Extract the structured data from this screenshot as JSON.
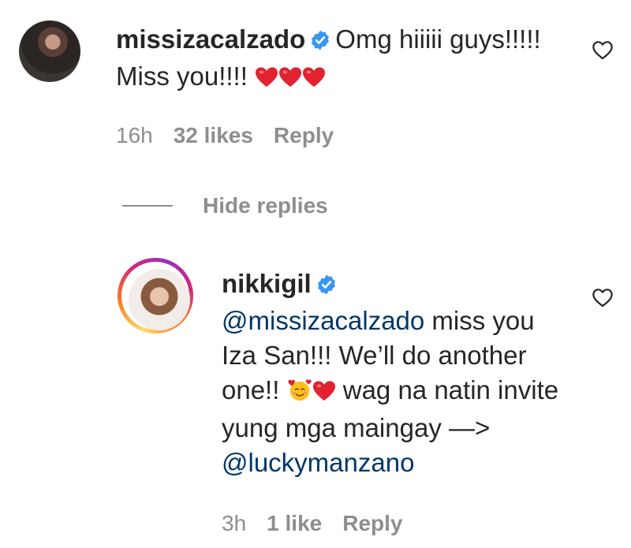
{
  "comments": [
    {
      "username": "missizacalzado",
      "text": "Omg hiiiii guys!!!!! Miss you!!!!",
      "emojis": [
        "red-heart",
        "red-heart",
        "red-heart"
      ],
      "time": "16h",
      "likes": "32 likes",
      "reply": "Reply"
    },
    {
      "username": "nikkigil",
      "mention1": "@missizacalzado",
      "text_part1": "miss you Iza San!!! We’ll do another one!!",
      "emojis": [
        "smiling-face-with-hearts",
        "red-heart"
      ],
      "text_part2": "wag na natin invite yung mga maingay —>",
      "mention2": "@luckymanzano",
      "time": "3h",
      "likes": "1 like",
      "reply": "Reply"
    }
  ],
  "hide_replies": "Hide replies",
  "colors": {
    "text": "#262626",
    "muted": "#8e8e8e",
    "mention": "#00376b",
    "verified": "#3897f0",
    "heart": "#ed4956"
  }
}
